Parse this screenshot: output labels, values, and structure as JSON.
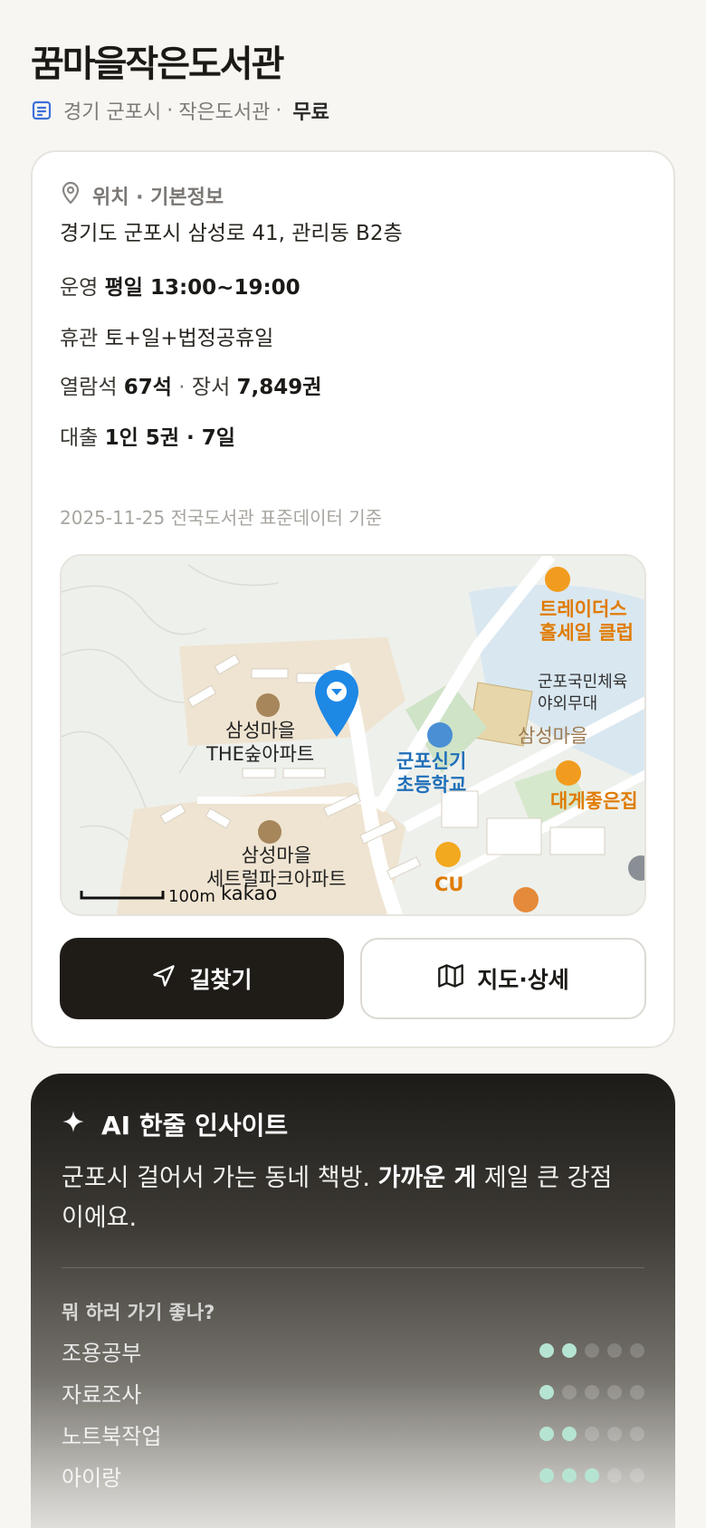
{
  "title": "꿈마을작은도서관",
  "subtitle": {
    "region": "경기 군포시",
    "sep1": "·",
    "type": "작은도서관",
    "sep2": "·",
    "fee": "무료"
  },
  "info": {
    "section_title": "위치 · 기본정보",
    "address": "경기도 군포시 삼성로 41, 관리동 B2층",
    "hours_label": "운영",
    "hours_value": "평일 13:00~19:00",
    "closed_label": "휴관",
    "closed_value": "토+일+법정공휴일",
    "seats_label": "열람석",
    "seats_value": "67석",
    "mid_sep": "·",
    "books_label": "장서",
    "books_value": "7,849권",
    "loan_label": "대출",
    "loan_value": "1인 5권 · 7일",
    "source": "2025-11-25 전국도서관 표준데이터 기준"
  },
  "map": {
    "labels": {
      "apt1": "삼성마을\nTHE숲아파트",
      "apt2": "삼성마을\n세트럴파크아파트",
      "school": "군포신기\n초등학교",
      "market": "트레이더스\n홀세일 클럽",
      "stage": "군포국민체육\n야외무대",
      "village": "삼성마을",
      "restaurant": "대게좋은집",
      "cu": "CU",
      "scale": "100m",
      "kakao": "kakao"
    }
  },
  "buttons": {
    "directions": "길찾기",
    "map_detail": "지도·상세"
  },
  "ai": {
    "title": "AI 한줄 인사이트",
    "text_before": "군포시 걸어서 가는 동네 책방. ",
    "text_bold": "가까운 게",
    "text_after": " 제일 큰 강점이에요.",
    "question": "뭐 하러 가기 좋나?",
    "ratings": [
      {
        "label": "조용공부",
        "score": 2,
        "max": 5
      },
      {
        "label": "자료조사",
        "score": 1,
        "max": 5
      },
      {
        "label": "노트북작업",
        "score": 2,
        "max": 5
      },
      {
        "label": "아이랑",
        "score": 3,
        "max": 5
      }
    ]
  },
  "colors": {
    "accent_dark": "#1f1c18",
    "dot_on": "#b6e4d2",
    "map_pin": "#1e88e5",
    "poi_orange": "#f29c1f",
    "poi_blue": "#1f6fb8",
    "poi_brown": "#9c7a52"
  }
}
